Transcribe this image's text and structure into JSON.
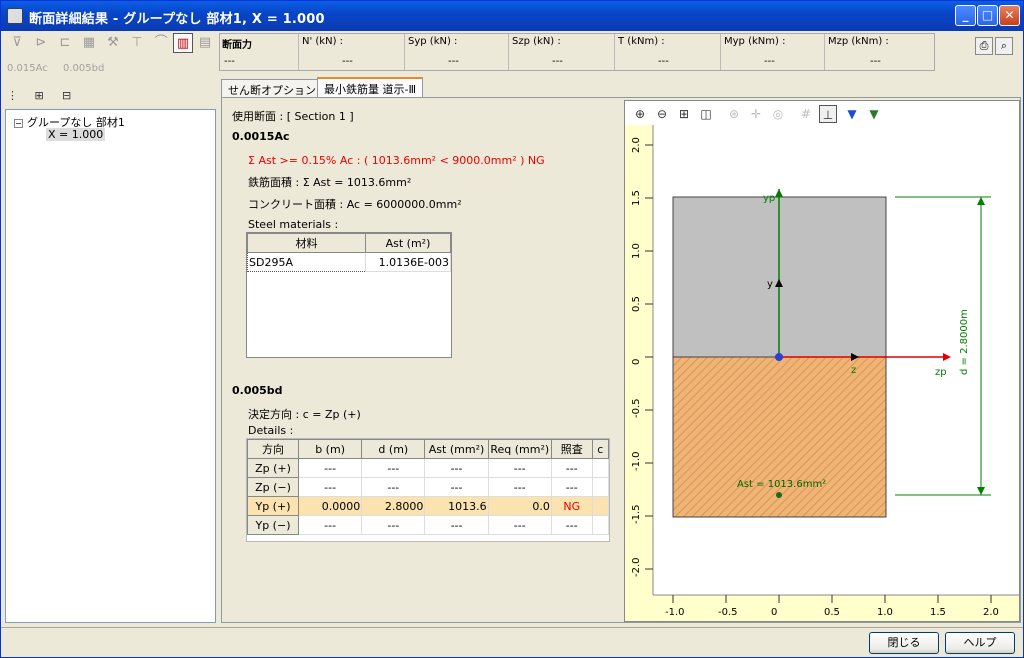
{
  "window": {
    "title": "断面詳細結果 - グループなし 部材1, X = 1.000",
    "minimize": "_",
    "maximize": "□",
    "close": "✕"
  },
  "mode_tabs": [
    "0.015Ac",
    "0.005bd"
  ],
  "tree": {
    "root": "グループなし 部材1",
    "child": "X = 1.000",
    "expander": "−"
  },
  "forces": {
    "label": "断面力",
    "columns": [
      {
        "head": "N' (kN) :",
        "value": "---"
      },
      {
        "head": "Syp (kN) :",
        "value": "---"
      },
      {
        "head": "Szp (kN) :",
        "value": "---"
      },
      {
        "head": "T (kNm) :",
        "value": "---"
      },
      {
        "head": "Myp (kNm) :",
        "value": "---"
      },
      {
        "head": "Mzp (kNm) :",
        "value": "---"
      }
    ],
    "first_value": "---"
  },
  "tabs": [
    {
      "label": "せん断オプション"
    },
    {
      "label": "最小鉄筋量 道示-Ⅲ"
    }
  ],
  "content": {
    "section_label": "使用断面 : [ Section 1 ]",
    "h1": "0.0015Ac",
    "check_line": "Σ Ast >= 0.15% Ac : ( 1013.6mm² < 9000.0mm² ) NG",
    "rebar_area": "鉄筋面積 : Σ Ast = 1013.6mm²",
    "concrete_area": "コンクリート面積 : Ac = 6000000.0mm²",
    "steel_label": "Steel materials :",
    "steel_headers": [
      "材料",
      "Ast (m²)"
    ],
    "steel_rows": [
      [
        "SD295A",
        "1.0136E-003"
      ]
    ],
    "h2": "0.005bd",
    "direction": "決定方向 : c = Zp (+)",
    "details_label": "Details :",
    "detail_headers": [
      "方向",
      "b (m)",
      "d (m)",
      "Ast (mm²)",
      "Req (mm²)",
      "照査",
      "c"
    ],
    "detail_rows": [
      [
        "Zp (+)",
        "---",
        "---",
        "---",
        "---",
        "---",
        ""
      ],
      [
        "Zp (−)",
        "---",
        "---",
        "---",
        "---",
        "---",
        ""
      ],
      [
        "Yp (+)",
        "0.0000",
        "2.8000",
        "1013.6",
        "0.0",
        "NG",
        ""
      ],
      [
        "Yp (−)",
        "---",
        "---",
        "---",
        "---",
        "---",
        ""
      ]
    ]
  },
  "plot": {
    "toolbar": [
      "zoom-in",
      "zoom-out",
      "fit",
      "window",
      "rotate",
      "pan",
      "orbit",
      "grid",
      "axis",
      "vertical-view",
      "section-view"
    ],
    "x_ticks": [
      "-1.0",
      "-0.5",
      "0",
      "0.5",
      "1.0",
      "1.5",
      "2.0"
    ],
    "y_ticks": [
      "2.0",
      "1.5",
      "1.0",
      "0.5",
      "0",
      "-0.5",
      "-1.0",
      "-1.5",
      "-2.0"
    ],
    "labels": {
      "yp": "yp",
      "y": "y",
      "z": "z",
      "zp": "zp",
      "dim": "d = 2.8000m",
      "ast": "Ast = 1013.6mm²"
    },
    "colors": {
      "upper": "#c0c0c0",
      "lower": "#f2b27a",
      "hatch": "#c9a040",
      "axis_green": "#008000",
      "axis_red": "#e00000"
    }
  },
  "buttons": {
    "close": "閉じる",
    "help": "ヘルプ"
  }
}
